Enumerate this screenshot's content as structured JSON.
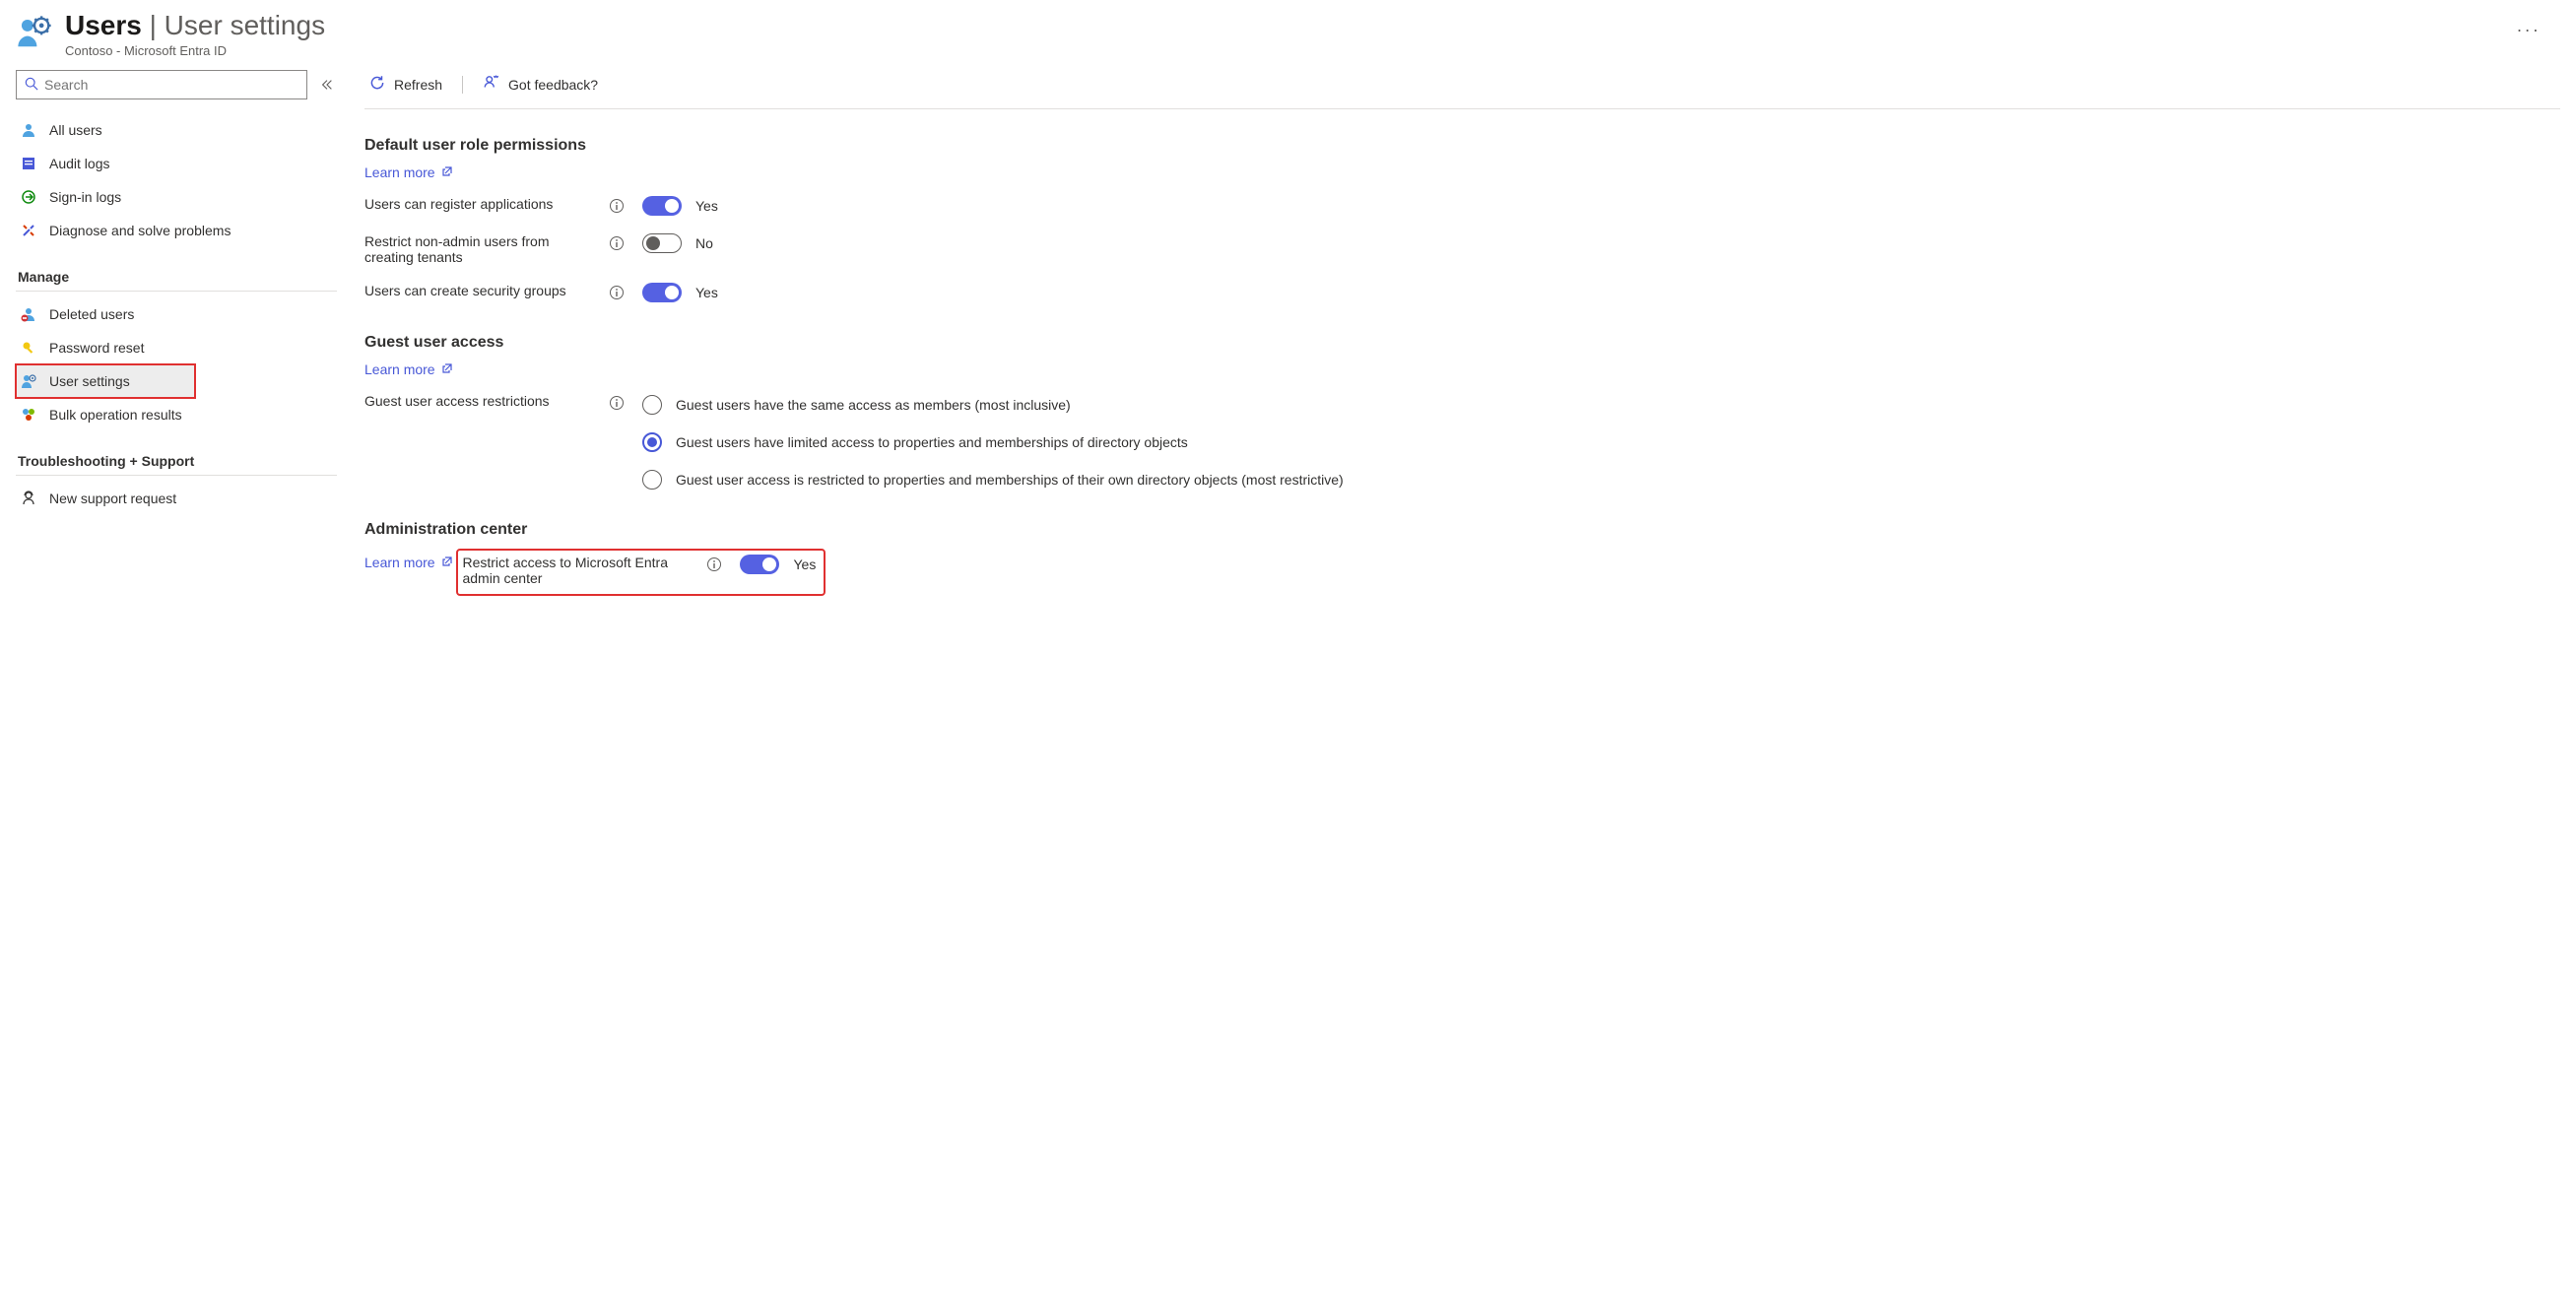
{
  "header": {
    "title_bold": "Users",
    "title_light": " | User settings",
    "subtitle": "Contoso - Microsoft Entra ID",
    "more": "···"
  },
  "search": {
    "placeholder": "Search"
  },
  "nav": {
    "top": [
      {
        "id": "all-users",
        "label": "All users"
      },
      {
        "id": "audit-logs",
        "label": "Audit logs"
      },
      {
        "id": "signin-logs",
        "label": "Sign-in logs"
      },
      {
        "id": "diagnose",
        "label": "Diagnose and solve problems"
      }
    ],
    "manage_heading": "Manage",
    "manage": [
      {
        "id": "deleted-users",
        "label": "Deleted users"
      },
      {
        "id": "password-reset",
        "label": "Password reset"
      },
      {
        "id": "user-settings",
        "label": "User settings"
      },
      {
        "id": "bulk-results",
        "label": "Bulk operation results"
      }
    ],
    "troubleshoot_heading": "Troubleshooting + Support",
    "troubleshoot": [
      {
        "id": "new-support",
        "label": "New support request"
      }
    ]
  },
  "toolbar": {
    "refresh": "Refresh",
    "feedback": "Got feedback?"
  },
  "sections": {
    "default_perms": {
      "title": "Default user role permissions",
      "learn_more": "Learn more",
      "rows": [
        {
          "label": "Users can register applications",
          "state": "on",
          "text": "Yes"
        },
        {
          "label": "Restrict non-admin users from creating tenants",
          "state": "off",
          "text": "No"
        },
        {
          "label": "Users can create security groups",
          "state": "on",
          "text": "Yes"
        }
      ]
    },
    "guest": {
      "title": "Guest user access",
      "learn_more": "Learn more",
      "label": "Guest user access restrictions",
      "options": [
        "Guest users have the same access as members (most inclusive)",
        "Guest users have limited access to properties and memberships of directory objects",
        "Guest user access is restricted to properties and memberships of their own directory objects (most restrictive)"
      ],
      "selected": 1
    },
    "admin": {
      "title": "Administration center",
      "learn_more": "Learn more",
      "row": {
        "label": "Restrict access to Microsoft Entra admin center",
        "state": "on",
        "text": "Yes"
      }
    }
  }
}
